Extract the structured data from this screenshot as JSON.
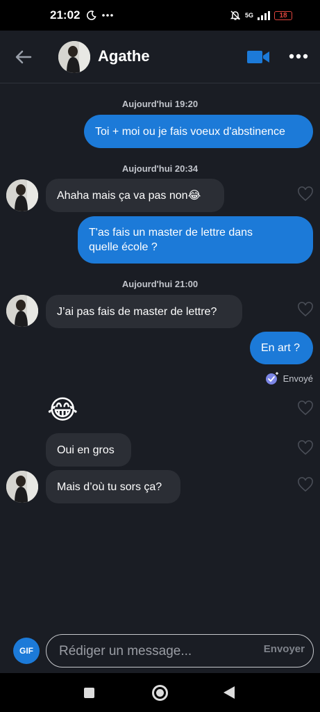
{
  "status_bar": {
    "time": "21:02",
    "network": "5G",
    "battery": "18"
  },
  "header": {
    "contact_name": "Agathe"
  },
  "messages": [
    {
      "type": "timestamp",
      "text": "Aujourd'hui 19:20"
    },
    {
      "type": "outgoing",
      "text": "Toi + moi ou je fais voeux d'abstinence"
    },
    {
      "type": "timestamp",
      "text": "Aujourd'hui 20:34"
    },
    {
      "type": "incoming",
      "text": "Ahaha mais ça va pas non😂"
    },
    {
      "type": "outgoing",
      "text_line1": "T'as fais un master de lettre dans",
      "text_line2": "quelle école ?"
    },
    {
      "type": "timestamp",
      "text": "Aujourd'hui 21:00"
    },
    {
      "type": "incoming",
      "text": "J’ai pas fais de master de lettre?"
    },
    {
      "type": "outgoing",
      "text": "En art ?"
    },
    {
      "type": "status",
      "text": "Envoyé"
    },
    {
      "type": "incoming",
      "text": "😂"
    },
    {
      "type": "incoming",
      "text": "Oui en gros"
    },
    {
      "type": "incoming",
      "text": "Mais d’où tu sors ça?"
    }
  ],
  "composer": {
    "gif_label": "GIF",
    "placeholder": "Rédiger un message...",
    "send_label": "Envoyer"
  },
  "colors": {
    "accent": "#1c7ad8",
    "background": "#1a1d24",
    "incoming_bubble": "#2b2e35"
  }
}
